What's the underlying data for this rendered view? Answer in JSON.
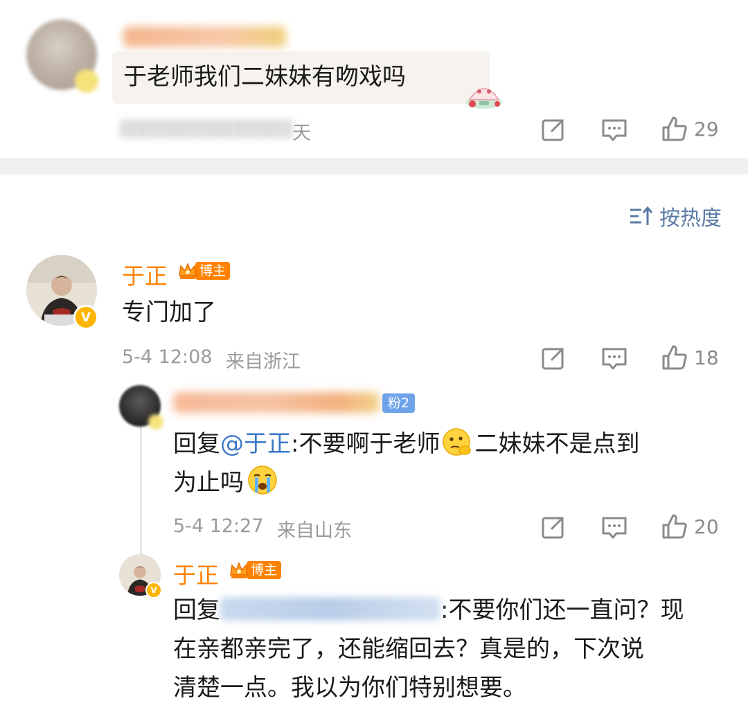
{
  "comment_top": {
    "text": "于老师我们二妹妹有吻戏吗",
    "meta_suffix": "天",
    "like_count": "29"
  },
  "sort": {
    "label": "按热度"
  },
  "comment_main": {
    "author": "于正",
    "host_badge": "博主",
    "text": "专门加了",
    "time": "5-4 12:08",
    "location": "来自浙江",
    "like_count": "18"
  },
  "reply_1": {
    "fan_badge": "粉2",
    "prefix": "回复",
    "mention": "@于正",
    "text_line1_a": ":不要啊于老师",
    "text_line1_b": "二妹妹不是点到",
    "text_line2": "为止吗",
    "time": "5-4 12:27",
    "location": "来自山东",
    "like_count": "20"
  },
  "reply_2": {
    "author": "于正",
    "host_badge": "博主",
    "prefix": "回复",
    "line1_after": ":不要你们还一直问？现",
    "line2": "在亲都亲完了，还能缩回去？真是的，下次说",
    "line3": "清楚一点。我以为你们特别想要。"
  },
  "icons": {
    "share": "share-icon",
    "comment": "comment-icon",
    "like": "thumbs-up-icon",
    "sort": "sort-icon",
    "verified": "verified-v-icon",
    "crown": "crown-icon"
  },
  "colors": {
    "name_orange": "#ff8200",
    "mention_blue": "#3a78c8",
    "fan_badge_blue": "#6ea3ea",
    "meta_gray": "#9a9a9a",
    "divider": "#f0f0f0"
  }
}
